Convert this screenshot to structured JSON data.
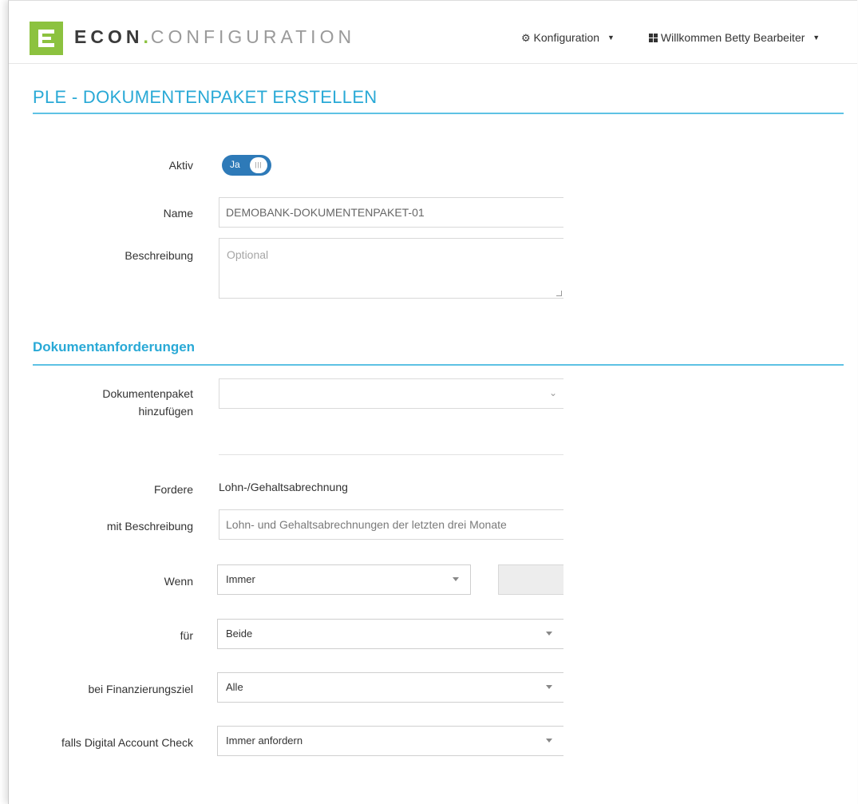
{
  "brand": {
    "word1": "ECON",
    "dot": ".",
    "word2": "CONFIGURATION",
    "color_green": "#8cc23f"
  },
  "nav": {
    "config_icon": "gear-icon",
    "config_label": "Konfiguration",
    "user_icon": "grid-icon",
    "user_label": "Willkommen Betty Bearbeiter"
  },
  "page": {
    "title": "PLE - DOKUMENTENPAKET ERSTELLEN",
    "accent_color": "#29a9d6"
  },
  "form": {
    "aktiv_label": "Aktiv",
    "aktiv_toggle_text": "Ja",
    "aktiv_value": true,
    "name_label": "Name",
    "name_value": "DEMOBANK-DOKUMENTENPAKET-01",
    "beschreibung_label": "Beschreibung",
    "beschreibung_placeholder": "Optional"
  },
  "requirements": {
    "section_title": "Dokumentanforderungen",
    "add_label_line1": "Dokumentenpaket",
    "add_label_line2": "hinzufügen",
    "add_value": "",
    "fordere_label": "Fordere",
    "fordere_value": "Lohn-/Gehaltsabrechnung",
    "beschreibung_label": "mit Beschreibung",
    "beschreibung_value": "Lohn- und Gehaltsabrechnungen der letzten drei Monate",
    "wenn_label": "Wenn",
    "wenn_value": "Immer",
    "fuer_label": "für",
    "fuer_value": "Beide",
    "ziel_label": "bei Finanzierungsziel",
    "ziel_value": "Alle",
    "dac_label": "falls Digital Account Check",
    "dac_value": "Immer anfordern"
  }
}
